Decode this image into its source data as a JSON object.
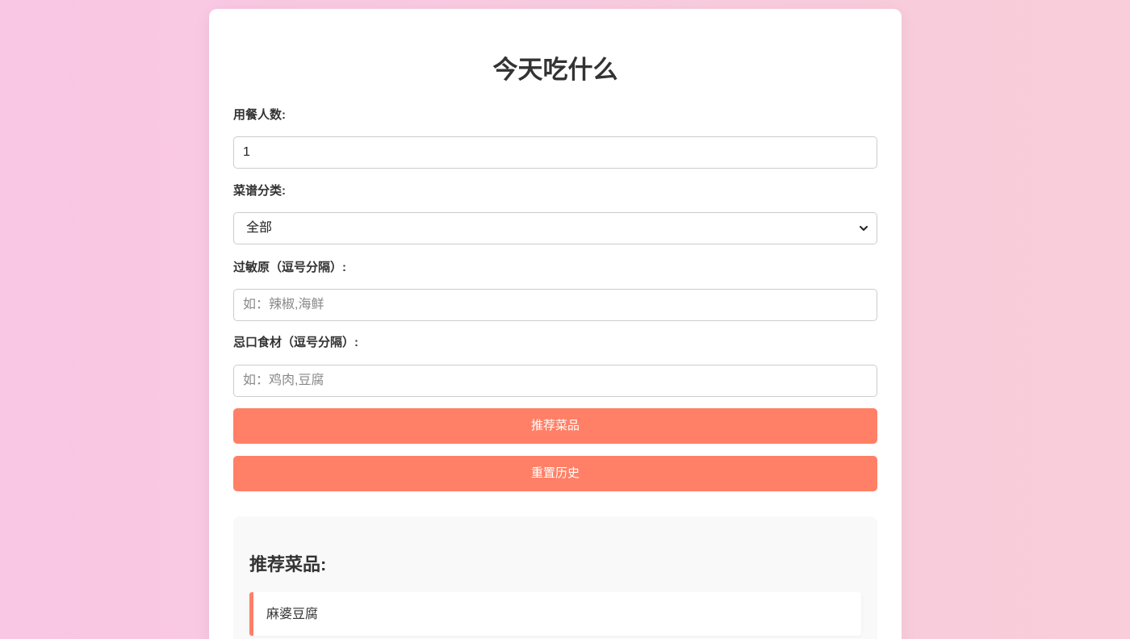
{
  "page": {
    "title": "今天吃什么"
  },
  "form": {
    "diners": {
      "label": "用餐人数:",
      "value": "1"
    },
    "category": {
      "label": "菜谱分类:",
      "selected": "全部"
    },
    "allergens": {
      "label": "过敏原（逗号分隔）:",
      "value": "",
      "placeholder": "如：辣椒,海鲜"
    },
    "avoid": {
      "label": "忌口食材（逗号分隔）:",
      "value": "",
      "placeholder": "如：鸡肉,豆腐"
    },
    "recommend_button": "推荐菜品",
    "reset_button": "重置历史"
  },
  "results": {
    "title": "推荐菜品:",
    "items": [
      {
        "name": "麻婆豆腐"
      }
    ]
  },
  "colors": {
    "accent": "#ff8066",
    "background_gradient": [
      "#f9c6e3",
      "#f9cdd9"
    ],
    "card": "#ffffff",
    "panel": "#f9f9f9",
    "text": "#333333"
  }
}
